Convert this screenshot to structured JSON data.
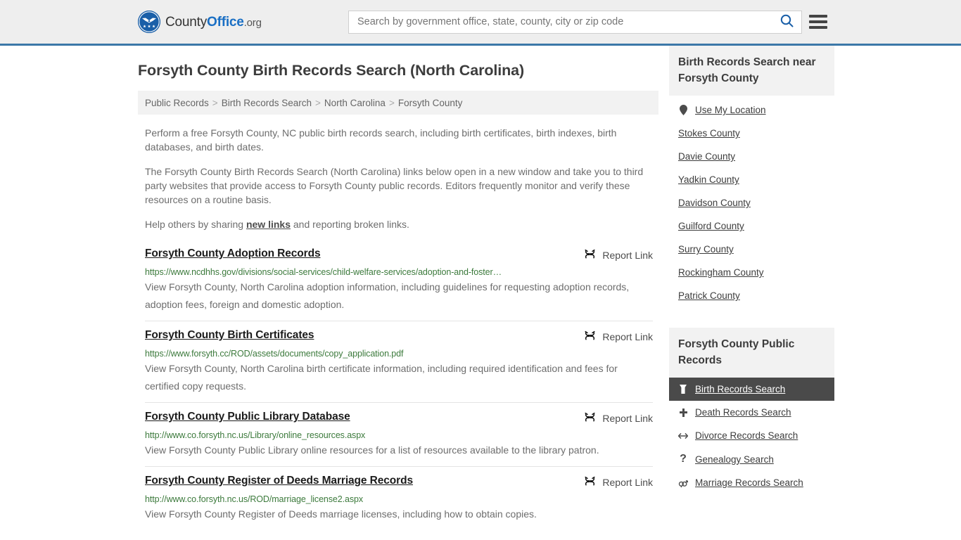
{
  "header": {
    "logo": {
      "part1": "County",
      "part2": "Office",
      "part3": ".org",
      "icon": "eagle-shield-logo"
    },
    "search": {
      "placeholder": "Search by government office, state, county, city or zip code",
      "value": "",
      "button_icon": "search-icon"
    },
    "menu_icon": "hamburger-menu-icon",
    "accent_color": "#3c78a8"
  },
  "main": {
    "title": "Forsyth County Birth Records Search (North Carolina)",
    "breadcrumb": [
      "Public Records",
      "Birth Records Search",
      "North Carolina",
      "Forsyth County"
    ],
    "breadcrumb_separator": ">",
    "paragraphs": [
      "Perform a free Forsyth County, NC public birth records search, including birth certificates, birth indexes, birth databases, and birth dates.",
      "The Forsyth County Birth Records Search (North Carolina) links below open in a new window and take you to third party websites that provide access to Forsyth County public records. Editors frequently monitor and verify these resources on a routine basis."
    ],
    "help_text_before": "Help others by sharing ",
    "help_link": "new links",
    "help_text_after": " and reporting broken links.",
    "report_label": "Report Link",
    "report_icon": "broken-link-icon",
    "results": [
      {
        "title": "Forsyth County Adoption Records",
        "url": "https://www.ncdhhs.gov/divisions/social-services/child-welfare-services/adoption-and-foster…",
        "description": "View Forsyth County, North Carolina adoption information, including guidelines for requesting adoption records, adoption fees, foreign and domestic adoption."
      },
      {
        "title": "Forsyth County Birth Certificates",
        "url": "https://www.forsyth.cc/ROD/assets/documents/copy_application.pdf",
        "description": "View Forsyth County, North Carolina birth certificate information, including required identification and fees for certified copy requests."
      },
      {
        "title": "Forsyth County Public Library Database",
        "url": "http://www.co.forsyth.nc.us/Library/online_resources.aspx",
        "description": "View Forsyth County Public Library online resources for a list of resources available to the library patron."
      },
      {
        "title": "Forsyth County Register of Deeds Marriage Records",
        "url": "http://www.co.forsyth.nc.us/ROD/marriage_license2.aspx",
        "description": "View Forsyth County Register of Deeds marriage licenses, including how to obtain copies."
      }
    ]
  },
  "sidebar": {
    "nearby": {
      "title": "Birth Records Search near Forsyth County",
      "items": [
        {
          "label": "Use My Location",
          "icon": "map-pin-icon"
        },
        {
          "label": "Stokes County",
          "icon": ""
        },
        {
          "label": "Davie County",
          "icon": ""
        },
        {
          "label": "Yadkin County",
          "icon": ""
        },
        {
          "label": "Davidson County",
          "icon": ""
        },
        {
          "label": "Guilford County",
          "icon": ""
        },
        {
          "label": "Surry County",
          "icon": ""
        },
        {
          "label": "Rockingham County",
          "icon": ""
        },
        {
          "label": "Patrick County",
          "icon": ""
        }
      ]
    },
    "records": {
      "title": "Forsyth County Public Records",
      "items": [
        {
          "label": "Birth Records Search",
          "icon": "baby-icon",
          "active": true
        },
        {
          "label": "Death Records Search",
          "icon": "cross-icon",
          "active": false
        },
        {
          "label": "Divorce Records Search",
          "icon": "left-right-arrow-icon",
          "active": false
        },
        {
          "label": "Genealogy Search",
          "icon": "question-mark-icon",
          "active": false
        },
        {
          "label": "Marriage Records Search",
          "icon": "gender-symbols-icon",
          "active": false
        }
      ]
    }
  }
}
